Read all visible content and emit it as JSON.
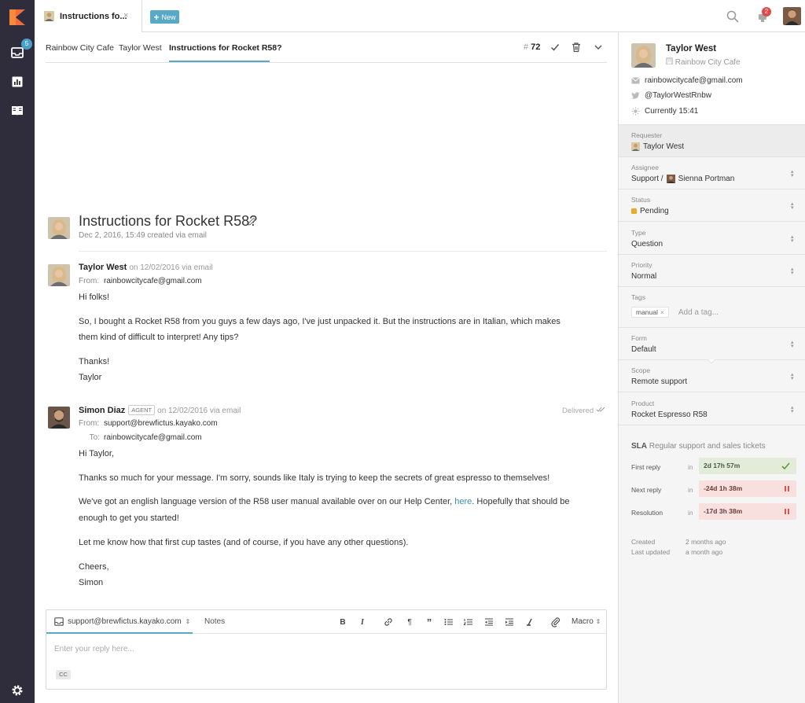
{
  "topbar": {
    "tab_title": "Instructions fo...",
    "tab_close": "×",
    "new_label": "New",
    "notification_count": "2"
  },
  "leftnav": {
    "inbox_count": "5",
    "icons": [
      "kayako-logo-icon",
      "inbox-icon",
      "reports-icon",
      "knowledge-base-icon",
      "settings-icon"
    ]
  },
  "breadcrumbs": {
    "items": [
      "Rainbow City Cafe",
      "Taylor West",
      "Instructions for Rocket R58?"
    ],
    "case_hash": "#",
    "case_number": "72"
  },
  "case": {
    "title": "Instructions for Rocket R58?",
    "meta": "Dec 2, 2016, 15:49 created via email"
  },
  "messages": [
    {
      "author": "Taylor West",
      "sub": "on 12/02/2016 via email",
      "from_label": "From:",
      "from": "rainbowcitycafe@gmail.com",
      "body": [
        "Hi folks!",
        "So, I bought a Rocket R58 from you guys a few days ago, I've just unpacked it. But the instructions are in Italian, which makes",
        "them kind of difficult to interpret! Any tips?",
        "Thanks!",
        "Taylor"
      ]
    },
    {
      "author": "Simon Diaz",
      "badge": "AGENT",
      "sub": "on 12/02/2016 via email",
      "status": "Delivered",
      "from_label": "From:",
      "from": "support@brewfictus.kayako.com",
      "to_label": "To:",
      "to": "rainbowcitycafe@gmail.com",
      "body": [
        "Hi Taylor,",
        "Thanks so much for your message. I'm sorry, sounds like Italy is trying to keep the secrets of great espresso to themselves!",
        "We've got an english language version of the R58 user manual available over on our Help Center,",
        "here",
        ". Hopefully that should be",
        "enough to get you started!",
        "Let me know how that first cup tastes (and of course, if you have any other questions).",
        "Cheers,",
        "Simon"
      ]
    }
  ],
  "composer": {
    "from": "support@brewfictus.kayako.com",
    "from_arrow": "⇕",
    "notes": "Notes",
    "macro": "Macro",
    "placeholder": "Enter your reply here...",
    "cc": "CC",
    "toolbar": [
      "bold-icon",
      "italic-icon",
      "link-icon",
      "paragraph-icon",
      "quote-icon",
      "bulleted-list-icon",
      "numbered-list-icon",
      "outdent-icon",
      "indent-icon",
      "clear-format-icon",
      "attachment-icon"
    ]
  },
  "sidebar": {
    "name": "Taylor West",
    "org": "Rainbow City Cafe",
    "email": "rainbowcitycafe@gmail.com",
    "twitter": "@TaylorWestRnbw",
    "time": "Currently 15:41",
    "fields": {
      "requester": {
        "label": "Requester",
        "value": "Taylor West"
      },
      "assignee": {
        "label": "Assignee",
        "team": "Support /",
        "value": "Sienna Portman"
      },
      "status": {
        "label": "Status",
        "value": "Pending",
        "color": "#e6ac2a"
      },
      "type": {
        "label": "Type",
        "value": "Question"
      },
      "priority": {
        "label": "Priority",
        "value": "Normal"
      },
      "tags": {
        "label": "Tags",
        "tag": "manual",
        "placeholder": "Add a tag..."
      },
      "form": {
        "label": "Form",
        "value": "Default"
      },
      "scope": {
        "label": "Scope",
        "value": "Remote support"
      },
      "product": {
        "label": "Product",
        "value": "Rocket Espresso R58"
      }
    },
    "sla": {
      "prefix": "SLA",
      "name": "Regular support and sales tickets",
      "in": "in",
      "rows": [
        {
          "label": "First reply",
          "value": "2d 17h 57m",
          "state": "ok"
        },
        {
          "label": "Next reply",
          "value": "-24d 1h 38m",
          "state": "breached"
        },
        {
          "label": "Resolution",
          "value": "-17d 3h 38m",
          "state": "breached"
        }
      ]
    },
    "meta": {
      "created_label": "Created",
      "created_value": "2 months ago",
      "updated_label": "Last updated",
      "updated_value": "a month ago"
    }
  }
}
